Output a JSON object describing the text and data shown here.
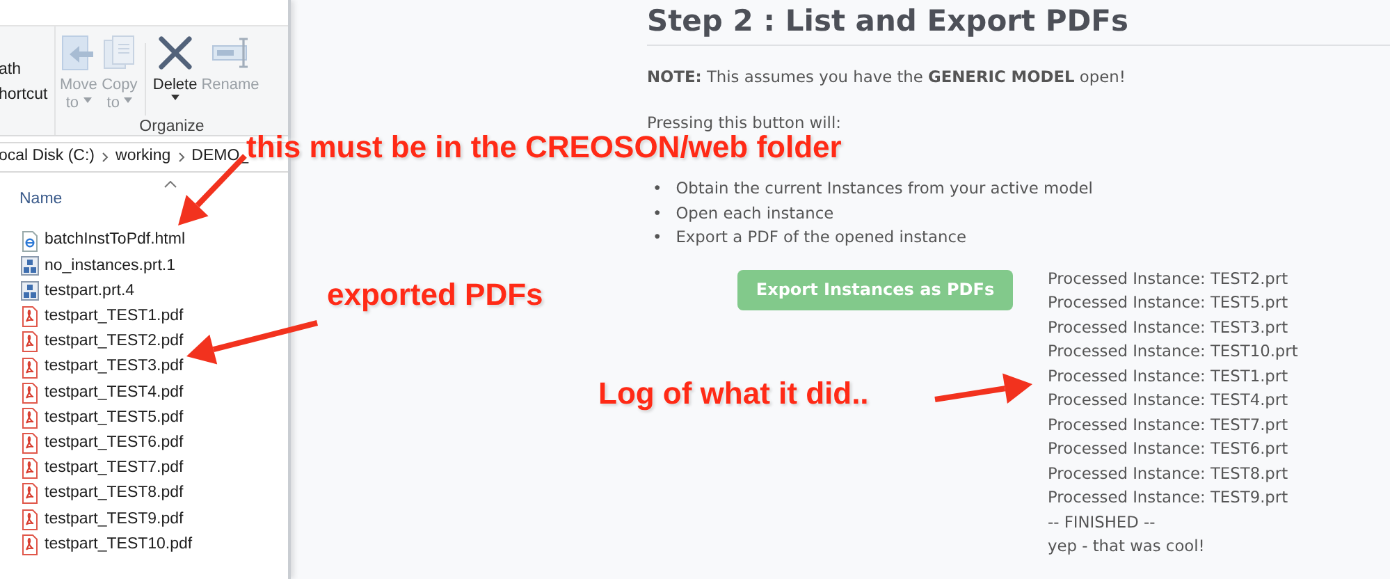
{
  "explorer": {
    "ribbon": {
      "cut_labels": [
        "ath",
        "hortcut"
      ],
      "commands": [
        {
          "kind": "move",
          "label": "Move",
          "sublabel": "to",
          "disabled": true
        },
        {
          "kind": "copy",
          "label": "Copy",
          "sublabel": "to",
          "disabled": true
        },
        {
          "kind": "delete",
          "label": "Delete",
          "disabled": false
        },
        {
          "kind": "rename",
          "label": "Rename",
          "disabled": true
        }
      ],
      "group": "Organize"
    },
    "breadcrumb": [
      "ocal Disk (C:)",
      "working",
      "DEMO_"
    ],
    "column": "Name",
    "files": [
      {
        "name": "batchInstToPdf.html",
        "kind": "html"
      },
      {
        "name": "no_instances.prt.1",
        "kind": "part"
      },
      {
        "name": "testpart.prt.4",
        "kind": "part"
      },
      {
        "name": "testpart_TEST1.pdf",
        "kind": "pdf"
      },
      {
        "name": "testpart_TEST2.pdf",
        "kind": "pdf"
      },
      {
        "name": "testpart_TEST3.pdf",
        "kind": "pdf"
      },
      {
        "name": "testpart_TEST4.pdf",
        "kind": "pdf"
      },
      {
        "name": "testpart_TEST5.pdf",
        "kind": "pdf"
      },
      {
        "name": "testpart_TEST6.pdf",
        "kind": "pdf"
      },
      {
        "name": "testpart_TEST7.pdf",
        "kind": "pdf"
      },
      {
        "name": "testpart_TEST8.pdf",
        "kind": "pdf"
      },
      {
        "name": "testpart_TEST9.pdf",
        "kind": "pdf"
      },
      {
        "name": "testpart_TEST10.pdf",
        "kind": "pdf"
      }
    ]
  },
  "page": {
    "heading": "Step 2 : List and Export PDFs",
    "note": "**NOTE:** This assumes you have the **GENERIC MODEL** open!",
    "intro": "Pressing this button will:",
    "steps": [
      {
        "bullet": "•",
        "text": "Obtain the current Instances from your active model"
      },
      {
        "bullet": "•",
        "text": "Open each instance"
      },
      {
        "bullet": "•",
        "text": "Export a PDF of the opened instance"
      }
    ],
    "button": "Export Instances as PDFs",
    "log": [
      "Processed Instance: TEST2.prt",
      "Processed Instance: TEST5.prt",
      "Processed Instance: TEST3.prt",
      "Processed Instance: TEST10.prt",
      "Processed Instance: TEST1.prt",
      "Processed Instance: TEST4.prt",
      "Processed Instance: TEST7.prt",
      "Processed Instance: TEST6.prt",
      "Processed Instance: TEST8.prt",
      "Processed Instance: TEST9.prt",
      "-- FINISHED --",
      "yep - that was cool!"
    ]
  },
  "annotations": [
    {
      "text": "this must be in the CREOSON/web folder"
    },
    {
      "text": "exported PDFs"
    },
    {
      "text": "Log of what it did.."
    }
  ]
}
